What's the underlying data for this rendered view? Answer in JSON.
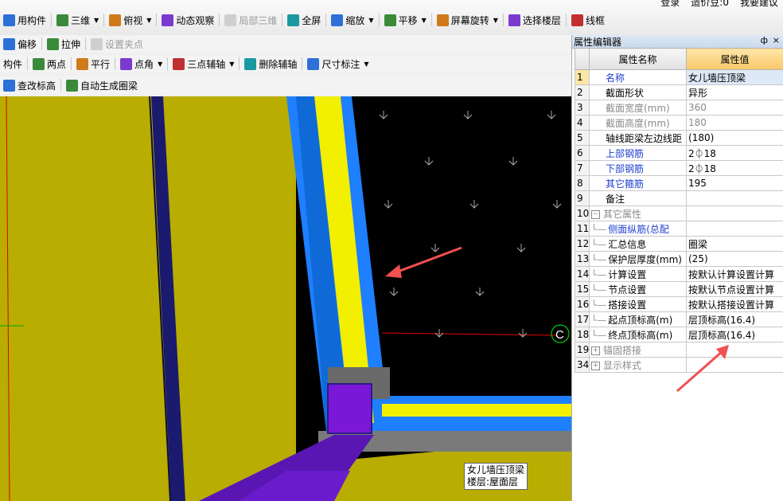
{
  "toolbar_top": {
    "items": [
      {
        "label": "用构件",
        "icon": "component-icon",
        "dropdown": false
      },
      {
        "label": "三维",
        "icon": "cube-3d-icon",
        "dropdown": true
      },
      {
        "label": "俯视",
        "icon": "top-view-icon",
        "dropdown": true
      },
      {
        "label": "动态观察",
        "icon": "orbit-icon",
        "dropdown": false
      },
      {
        "label": "局部三维",
        "icon": "local-3d-icon",
        "dropdown": false,
        "disabled": true
      },
      {
        "label": "全屏",
        "icon": "fullscreen-icon",
        "dropdown": false
      },
      {
        "label": "缩放",
        "icon": "zoom-icon",
        "dropdown": true
      },
      {
        "label": "平移",
        "icon": "pan-icon",
        "dropdown": true
      },
      {
        "label": "屏幕旋转",
        "icon": "rotate-icon",
        "dropdown": true
      },
      {
        "label": "选择楼层",
        "icon": "floor-select-icon",
        "dropdown": false
      },
      {
        "label": "线框",
        "icon": "wireframe-icon",
        "dropdown": false
      }
    ],
    "right_links": [
      "登录",
      "造价豆:0",
      "我要建议"
    ]
  },
  "toolbar_edit": {
    "items": [
      {
        "label": "偏移",
        "icon": "offset-icon"
      },
      {
        "label": "拉伸",
        "icon": "stretch-icon"
      },
      {
        "label": "设置夹点",
        "icon": "grip-icon",
        "disabled": true
      }
    ]
  },
  "toolbar_axis": {
    "items": [
      {
        "label": "构件",
        "icon": "",
        "dropdown": false
      },
      {
        "label": "两点",
        "icon": "two-point-icon",
        "dropdown": false
      },
      {
        "label": "平行",
        "icon": "parallel-icon",
        "dropdown": false
      },
      {
        "label": "点角",
        "icon": "point-angle-icon",
        "dropdown": true
      },
      {
        "label": "三点辅轴",
        "icon": "three-point-axis-icon",
        "dropdown": true
      },
      {
        "label": "删除辅轴",
        "icon": "delete-axis-icon",
        "dropdown": false
      },
      {
        "label": "尺寸标注",
        "icon": "dimension-icon",
        "dropdown": true
      }
    ]
  },
  "toolbar_beam": {
    "items": [
      {
        "label": "查改标高",
        "icon": "elevation-icon"
      },
      {
        "label": "自动生成圈梁",
        "icon": "auto-ring-beam-icon"
      }
    ]
  },
  "property_editor": {
    "title": "属性编辑器",
    "pin_label": "ф",
    "close_label": "×",
    "col_name": "属性名称",
    "col_value": "属性值",
    "rows": [
      {
        "num": "1",
        "name": "名称",
        "value": "女儿墙压顶梁",
        "style": "blue",
        "selected": true
      },
      {
        "num": "2",
        "name": "截面形状",
        "value": "异形",
        "style": ""
      },
      {
        "num": "3",
        "name": "截面宽度(mm)",
        "value": "360",
        "style": "gray"
      },
      {
        "num": "4",
        "name": "截面高度(mm)",
        "value": "180",
        "style": "gray"
      },
      {
        "num": "5",
        "name": "轴线距梁左边线距",
        "value": "(180)",
        "style": ""
      },
      {
        "num": "6",
        "name": "上部钢筋",
        "value": "2⏀18",
        "style": "blue"
      },
      {
        "num": "7",
        "name": "下部钢筋",
        "value": "2⏀18",
        "style": "blue"
      },
      {
        "num": "8",
        "name": "其它箍筋",
        "value": "195",
        "style": "blue"
      },
      {
        "num": "9",
        "name": "备注",
        "value": "",
        "style": ""
      },
      {
        "num": "10",
        "name": "其它属性",
        "value": "",
        "style": "gray",
        "group": "minus"
      },
      {
        "num": "11",
        "name": "侧面纵筋(总配",
        "value": "",
        "style": "blue",
        "child": true
      },
      {
        "num": "12",
        "name": "汇总信息",
        "value": "圈梁",
        "style": "",
        "child": true
      },
      {
        "num": "13",
        "name": "保护层厚度(mm)",
        "value": "(25)",
        "style": "",
        "child": true
      },
      {
        "num": "14",
        "name": "计算设置",
        "value": "按默认计算设置计算",
        "style": "",
        "child": true
      },
      {
        "num": "15",
        "name": "节点设置",
        "value": "按默认节点设置计算",
        "style": "",
        "child": true
      },
      {
        "num": "16",
        "name": "搭接设置",
        "value": "按默认搭接设置计算",
        "style": "",
        "child": true
      },
      {
        "num": "17",
        "name": "起点顶标高(m)",
        "value": "层顶标高(16.4)",
        "style": "",
        "child": true
      },
      {
        "num": "18",
        "name": "终点顶标高(m)",
        "value": "层顶标高(16.4)",
        "style": "",
        "child": true
      },
      {
        "num": "19",
        "name": "锚固搭接",
        "value": "",
        "style": "gray",
        "group": "plus"
      },
      {
        "num": "34",
        "name": "显示样式",
        "value": "",
        "style": "gray",
        "group": "plus"
      }
    ]
  },
  "viewport": {
    "tooltip_line1": "女儿墙压顶梁",
    "tooltip_line2": "楼层:屋面层",
    "cursor_label": "C",
    "colors": {
      "wall_yellow": "#b8ad00",
      "beam_blue": "#1e7fff",
      "beam_yellow": "#f2ef00",
      "beam_purple": "#7b17d6",
      "slab_black": "#000000",
      "grid_red": "#e00000",
      "arrow_red": "#f05050"
    }
  }
}
